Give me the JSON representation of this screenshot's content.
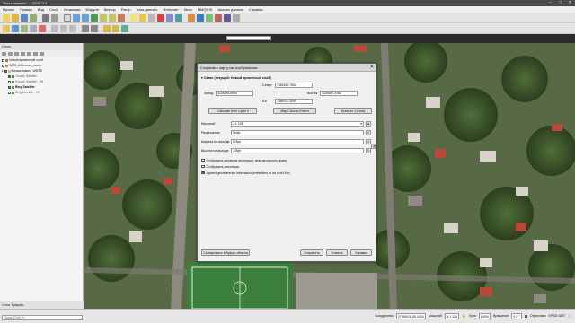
{
  "window": {
    "title": "*Без названия — QGIS 3.0",
    "controls": [
      "–",
      "□",
      "✕"
    ]
  },
  "menu": [
    "Проект",
    "Правка",
    "Вид",
    "Слой",
    "Установки",
    "Модули",
    "Вектор",
    "Растр",
    "База данных",
    "Интернет",
    "Меш",
    "MMQGIS",
    "Анализ данных",
    "Справка"
  ],
  "layers": {
    "panel_title": "Слои",
    "items": [
      {
        "label": "Новый временный слой",
        "checked": false,
        "indent": 0,
        "bold": false
      },
      {
        "label": "WMS_difference_vector",
        "checked": false,
        "indent": 0,
        "bold": false
      },
      {
        "label": "Космоснимки - WMTS",
        "checked": true,
        "indent": 0,
        "bold": false
      },
      {
        "label": "Google Satellite",
        "checked": true,
        "indent": 1,
        "bold": false
      },
      {
        "label": "Google Satellite - НК",
        "checked": false,
        "indent": 1,
        "bold": false
      },
      {
        "label": "Bing Satellite",
        "checked": true,
        "indent": 1,
        "bold": true
      },
      {
        "label": "Bing Satellite - НК",
        "checked": false,
        "indent": 1,
        "bold": false
      }
    ],
    "tabs": [
      "Слои",
      "Браузер"
    ],
    "search_placeholder": "Поиск (Ctrl+K)"
  },
  "status": {
    "coord_label": "Координаты",
    "coord_value": "37.96021,55.4334",
    "scale_label": "Масштаб",
    "scale_value": "1:1 128",
    "magnifier_label": "Лупа",
    "magnifier_value": "100%",
    "rotation_label": "Вращение",
    "rotation_value": "0,0 °",
    "render_label": "Отрисовка",
    "crs": "EPSG:3857"
  },
  "dialog": {
    "title": "Сохранить карту как изображение",
    "group_title": "Охват (текущий: Новый временный слой)",
    "north_label": "Север",
    "north_value": "7485180.7854",
    "west_label": "Запад",
    "west_value": "4228198.6904",
    "east_label": "Восток",
    "east_value": "4228387.2082",
    "south_label": "Юг",
    "south_value": "7484911.2539",
    "calc_button": "Calculate from Layer",
    "canvas_button": "Map Canvas Extent",
    "draw_button": "Draw on Canvas",
    "scale_label": "Масштаб",
    "scale_value": "1:1 128",
    "resolution_label": "Разрешение",
    "resolution_value": "96dpi",
    "width_label": "Ширина на выходе",
    "width_value": "829px",
    "height_label": "Высота на выходе",
    "height_value": "749px",
    "checkboxes": [
      {
        "label": "Отображать активные аннотации: знак авторского права",
        "checked": false
      },
      {
        "label": "Отображать аннотации",
        "checked": false
      },
      {
        "label": "Append georeference information (embedded or via world file)",
        "checked": true
      }
    ],
    "clipboard_button": "Скопировать в буфер обмена",
    "save_button": "Сохранить",
    "cancel_button": "Отмена",
    "help_button": "Справка"
  }
}
